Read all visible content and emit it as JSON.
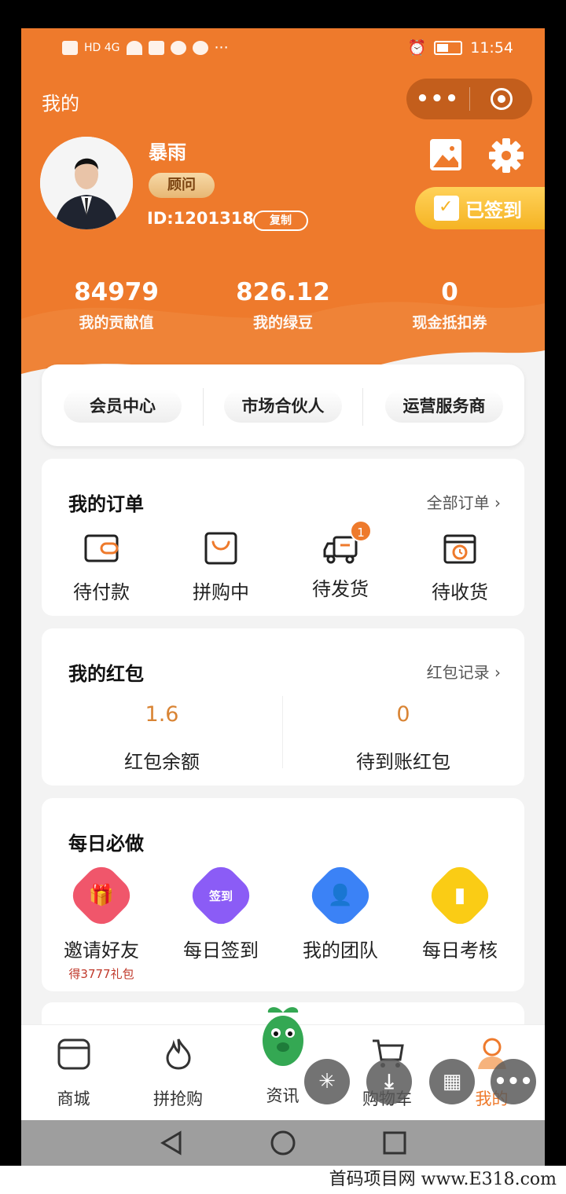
{
  "status_bar": {
    "left_indicators": "HD 4G",
    "time": "11:54",
    "more": "···"
  },
  "header": {
    "title": "我的",
    "capsule_more": "•••"
  },
  "profile": {
    "name": "暴雨",
    "role": "顾问",
    "id_text": "ID:1201318",
    "copy_label": "复制",
    "signin_label": "已签到"
  },
  "stats": [
    {
      "value": "84979",
      "label": "我的贡献值"
    },
    {
      "value": "826.12",
      "label": "我的绿豆"
    },
    {
      "value": "0",
      "label": "现金抵扣券"
    }
  ],
  "membership": [
    "会员中心",
    "市场合伙人",
    "运营服务商"
  ],
  "orders": {
    "title": "我的订单",
    "link": "全部订单",
    "items": [
      {
        "label": "待付款",
        "icon": "wallet-icon"
      },
      {
        "label": "拼购中",
        "icon": "shopping-bag-icon"
      },
      {
        "label": "待发货",
        "icon": "truck-icon",
        "badge": "1"
      },
      {
        "label": "待收货",
        "icon": "box-clock-icon"
      }
    ]
  },
  "red_packet": {
    "title": "我的红包",
    "link": "红包记录",
    "balance": {
      "value": "1.6",
      "label": "红包余额"
    },
    "pending": {
      "value": "0",
      "label": "待到账红包"
    }
  },
  "daily": {
    "title": "每日必做",
    "items": [
      {
        "label": "邀请好友",
        "sub": "得3777礼包",
        "icon": "gift-icon",
        "color": "#f0566b"
      },
      {
        "label": "每日签到",
        "icon_text": "签到",
        "icon": "calendar-checkin-icon",
        "color": "#8b5cf6"
      },
      {
        "label": "我的团队",
        "icon": "team-icon",
        "color": "#3b82f6"
      },
      {
        "label": "每日考核",
        "icon": "bar-chart-icon",
        "color": "#facc15"
      }
    ]
  },
  "tabbar": [
    {
      "label": "商城",
      "icon": "store-icon"
    },
    {
      "label": "拼抢购",
      "icon": "flame-icon"
    },
    {
      "label": "资讯",
      "icon": "mascot-icon"
    },
    {
      "label": "购物车",
      "icon": "cart-icon"
    },
    {
      "label": "我的",
      "icon": "user-icon",
      "active": true
    }
  ],
  "colors": {
    "brand": "#ee7a2c",
    "accent_gold": "#f5b324",
    "value_orange": "#d98434"
  },
  "watermark": "首码项目网 www.E318.com"
}
